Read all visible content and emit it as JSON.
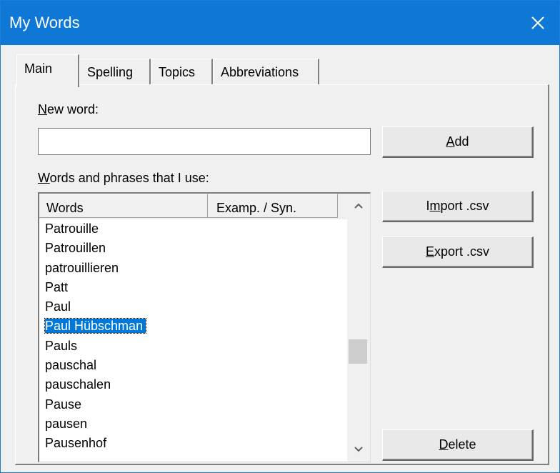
{
  "window": {
    "title": "My Words"
  },
  "tabs": [
    {
      "label": "Main"
    },
    {
      "label": "Spelling"
    },
    {
      "label": "Topics"
    },
    {
      "label": "Abbreviations"
    }
  ],
  "new_word": {
    "label_hotkey": "N",
    "label_rest": "ew word:",
    "value": "",
    "placeholder": ""
  },
  "buttons": {
    "add_hotkey": "A",
    "add_rest": "dd",
    "import_pre": "I",
    "import_hotkey": "m",
    "import_rest": "port .csv",
    "export_hotkey": "E",
    "export_rest": "xport .csv",
    "delete_hotkey": "D",
    "delete_rest": "elete"
  },
  "words_list": {
    "label_hotkey": "W",
    "label_rest": "ords and phrases that I use:",
    "columns": [
      "Words",
      "Examp. / Syn."
    ],
    "rows": [
      "Patrouille",
      "Patrouillen",
      "patrouillieren",
      "Patt",
      "Paul",
      "Paul Hübschman",
      "Pauls",
      "pauschal",
      "pauschalen",
      "Pause",
      "pausen",
      "Pausenhof"
    ],
    "selected_index": 5
  },
  "icons": {
    "close": "close-icon",
    "scroll_up": "chevron-up-icon",
    "scroll_down": "chevron-down-icon"
  },
  "colors": {
    "titlebar": "#0f78d7",
    "selection": "#0078d7"
  }
}
